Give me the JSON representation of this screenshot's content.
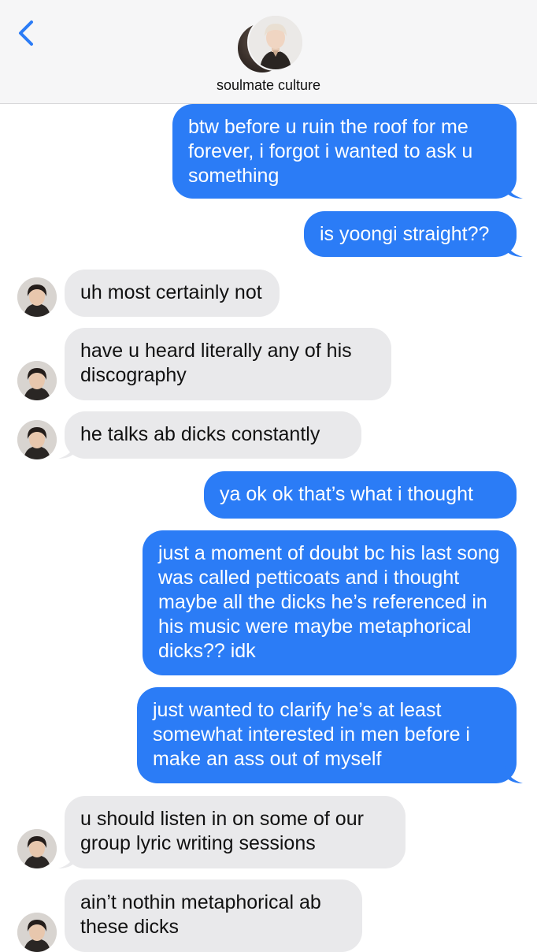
{
  "header": {
    "contact_name": "soulmate culture",
    "back_icon": "chevron-left-icon"
  },
  "colors": {
    "sent_bubble": "#2b7cf6",
    "received_bubble": "#e9e9eb",
    "header_bg": "#f6f6f7",
    "back_chevron": "#2b7cf6"
  },
  "messages": [
    {
      "from": "me",
      "text": "btw before u ruin the roof for me forever, i forgot i wanted to ask u something"
    },
    {
      "from": "me",
      "text": "is yoongi straight??"
    },
    {
      "from": "them",
      "text": "uh most certainly not"
    },
    {
      "from": "them",
      "text": "have u heard literally any of his discography"
    },
    {
      "from": "them",
      "text": "he talks ab dicks constantly"
    },
    {
      "from": "me",
      "text": "ya ok ok that’s what i thought"
    },
    {
      "from": "me",
      "text": "just a moment of doubt bc his last song was called petticoats and i thought maybe all the dicks he’s referenced in his music were maybe metaphorical dicks?? idk"
    },
    {
      "from": "me",
      "text": "just wanted to clarify he’s at least somewhat interested in men before i make an ass out of myself"
    },
    {
      "from": "them",
      "text": "u should listen in on some of our group lyric writing sessions"
    },
    {
      "from": "them",
      "text": "ain’t nothin metaphorical ab these dicks"
    }
  ]
}
